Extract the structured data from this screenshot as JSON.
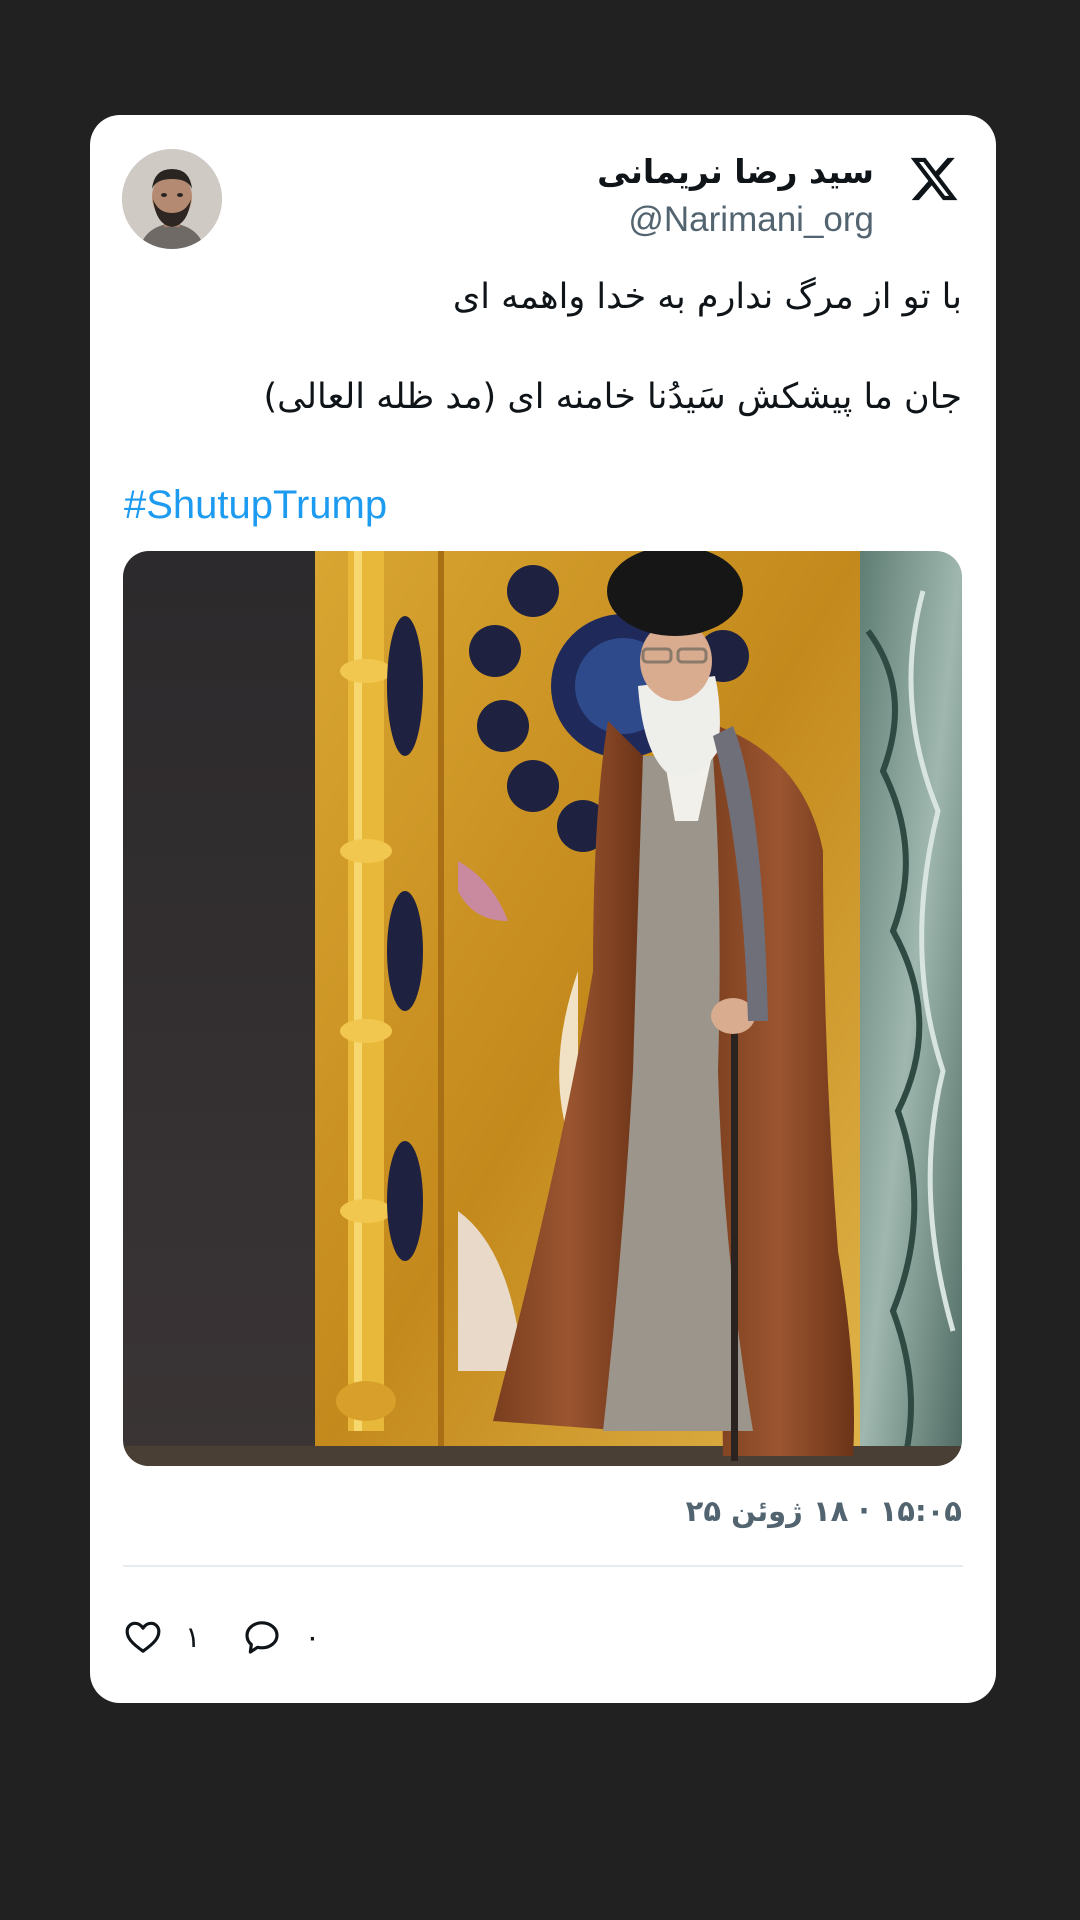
{
  "tweet": {
    "author_name": "سید رضا نریمانی",
    "author_handle": "@Narimani_org",
    "platform_logo": "x-logo-icon",
    "text_line_1": "با تو از مرگ ندارم به خدا واهمه ای",
    "text_line_2": "جان ما پیشکش سَیدُنا خامنه ای (مد ظله العالی)",
    "hashtag": "#ShutupTrump",
    "timestamp": "۱۵:۰۵ · ۱۸ ژوئن ۲۵",
    "likes_count": "۱",
    "replies_count": "۰"
  },
  "colors": {
    "background": "#212121",
    "card": "#ffffff",
    "hashtag": "#1d9bf0",
    "secondary_text": "#536471"
  }
}
